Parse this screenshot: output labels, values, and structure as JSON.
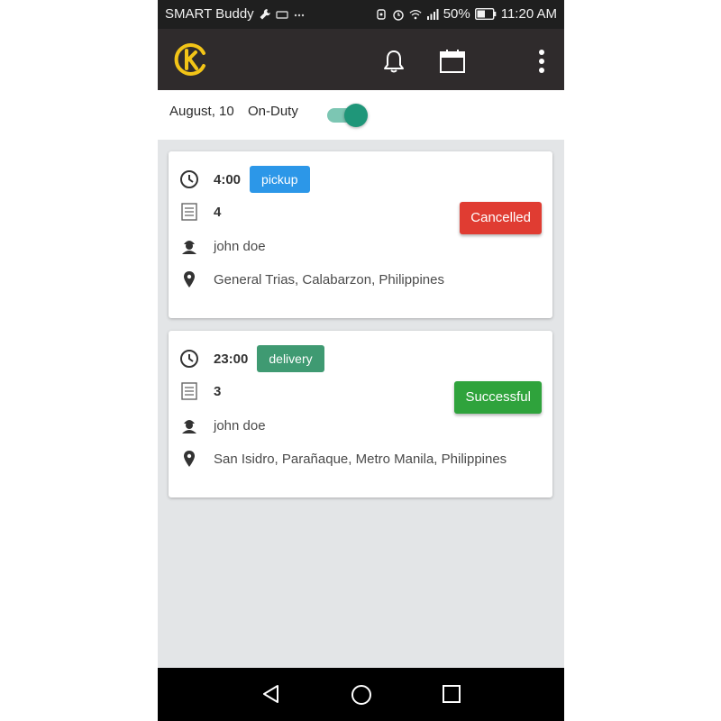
{
  "status_bar": {
    "carrier": "SMART Buddy",
    "battery": "50%",
    "time": "11:20 AM",
    "icons": [
      "wrench-icon",
      "notification-icon",
      "more-dots-icon",
      "sync-icon",
      "alarm-icon",
      "wifi-icon",
      "signal-icon",
      "battery-icon"
    ]
  },
  "app_bar": {
    "logo": "k-logo",
    "logo_color": "#f2c417",
    "actions": [
      "bell-icon",
      "calendar-icon",
      "overflow-menu-icon"
    ]
  },
  "duty": {
    "date": "August, 10",
    "status_label": "On-Duty",
    "on": true,
    "toggle_color": "#1f9679"
  },
  "orders": [
    {
      "time": "4:00",
      "type": "pickup",
      "type_color": "#2c97e8",
      "items": "4",
      "customer": "john doe",
      "address": "General Trias, Calabarzon, Philippines",
      "status": "Cancelled",
      "status_color": "#e03c32"
    },
    {
      "time": "23:00",
      "type": "delivery",
      "type_color": "#3f9a72",
      "items": "3",
      "customer": "john doe",
      "address": "San Isidro, Parañaque, Metro Manila, Philippines",
      "status": "Successful",
      "status_color": "#2fa33c"
    }
  ],
  "nav_bar": [
    "back-icon",
    "home-icon",
    "recent-apps-icon"
  ]
}
